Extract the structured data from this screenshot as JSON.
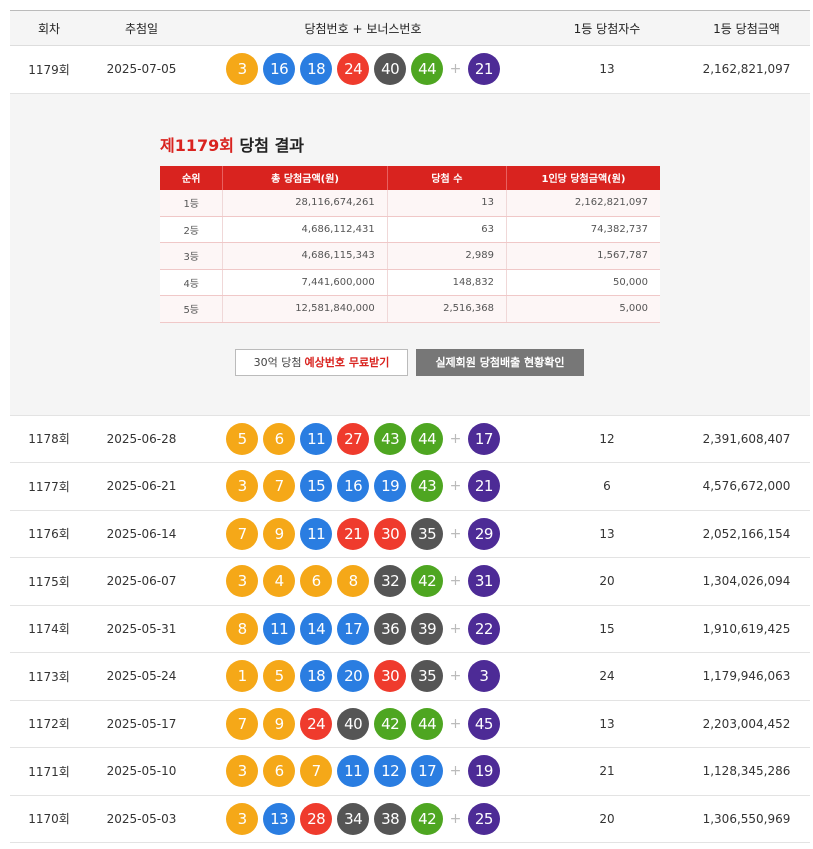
{
  "header": {
    "round": "회차",
    "date": "추첨일",
    "numbers": "당첨번호 + 보너스번호",
    "winners": "1등 당첨자수",
    "amount": "1등 당첨금액"
  },
  "colors": {
    "yellow": "#f5a818",
    "blue": "#2a7de1",
    "red": "#ef3b2d",
    "gray": "#555555",
    "green": "#4ea621",
    "bonus": "#4d2b96",
    "accent": "#d9231f"
  },
  "rows": [
    {
      "round": "1179회",
      "date": "2025-07-05",
      "balls": [
        "3",
        "16",
        "18",
        "24",
        "40",
        "44"
      ],
      "colors": [
        "y",
        "b",
        "b",
        "r",
        "g",
        "gr"
      ],
      "bonus": "21",
      "winners": "13",
      "amount": "2,162,821,097"
    },
    {
      "round": "1178회",
      "date": "2025-06-28",
      "balls": [
        "5",
        "6",
        "11",
        "27",
        "43",
        "44"
      ],
      "colors": [
        "y",
        "y",
        "b",
        "r",
        "gr",
        "gr"
      ],
      "bonus": "17",
      "winners": "12",
      "amount": "2,391,608,407"
    },
    {
      "round": "1177회",
      "date": "2025-06-21",
      "balls": [
        "3",
        "7",
        "15",
        "16",
        "19",
        "43"
      ],
      "colors": [
        "y",
        "y",
        "b",
        "b",
        "b",
        "gr"
      ],
      "bonus": "21",
      "winners": "6",
      "amount": "4,576,672,000"
    },
    {
      "round": "1176회",
      "date": "2025-06-14",
      "balls": [
        "7",
        "9",
        "11",
        "21",
        "30",
        "35"
      ],
      "colors": [
        "y",
        "y",
        "b",
        "r",
        "r",
        "g"
      ],
      "bonus": "29",
      "winners": "13",
      "amount": "2,052,166,154"
    },
    {
      "round": "1175회",
      "date": "2025-06-07",
      "balls": [
        "3",
        "4",
        "6",
        "8",
        "32",
        "42"
      ],
      "colors": [
        "y",
        "y",
        "y",
        "y",
        "g",
        "gr"
      ],
      "bonus": "31",
      "winners": "20",
      "amount": "1,304,026,094"
    },
    {
      "round": "1174회",
      "date": "2025-05-31",
      "balls": [
        "8",
        "11",
        "14",
        "17",
        "36",
        "39"
      ],
      "colors": [
        "y",
        "b",
        "b",
        "b",
        "g",
        "g"
      ],
      "bonus": "22",
      "winners": "15",
      "amount": "1,910,619,425"
    },
    {
      "round": "1173회",
      "date": "2025-05-24",
      "balls": [
        "1",
        "5",
        "18",
        "20",
        "30",
        "35"
      ],
      "colors": [
        "y",
        "y",
        "b",
        "b",
        "r",
        "g"
      ],
      "bonus": "3",
      "winners": "24",
      "amount": "1,179,946,063"
    },
    {
      "round": "1172회",
      "date": "2025-05-17",
      "balls": [
        "7",
        "9",
        "24",
        "40",
        "42",
        "44"
      ],
      "colors": [
        "y",
        "y",
        "r",
        "g",
        "gr",
        "gr"
      ],
      "bonus": "45",
      "winners": "13",
      "amount": "2,203,004,452"
    },
    {
      "round": "1171회",
      "date": "2025-05-10",
      "balls": [
        "3",
        "6",
        "7",
        "11",
        "12",
        "17"
      ],
      "colors": [
        "y",
        "y",
        "y",
        "b",
        "b",
        "b"
      ],
      "bonus": "19",
      "winners": "21",
      "amount": "1,128,345,286"
    },
    {
      "round": "1170회",
      "date": "2025-05-03",
      "balls": [
        "3",
        "13",
        "28",
        "34",
        "38",
        "42"
      ],
      "colors": [
        "y",
        "b",
        "r",
        "g",
        "g",
        "gr"
      ],
      "bonus": "25",
      "winners": "20",
      "amount": "1,306,550,969"
    }
  ],
  "plus_symbol": "+",
  "detail": {
    "title_round": "제1179회",
    "title_rest": " 당첨 결과",
    "table_headers": [
      "순위",
      "총 당첨금액(원)",
      "당첨 수",
      "1인당 당첨금액(원)"
    ],
    "table_rows": [
      [
        "1등",
        "28,116,674,261",
        "13",
        "2,162,821,097"
      ],
      [
        "2등",
        "4,686,112,431",
        "63",
        "74,382,737"
      ],
      [
        "3등",
        "4,686,115,343",
        "2,989",
        "1,567,787"
      ],
      [
        "4등",
        "7,441,600,000",
        "148,832",
        "50,000"
      ],
      [
        "5등",
        "12,581,840,000",
        "2,516,368",
        "5,000"
      ]
    ],
    "btn_predict_prefix": "30억 당첨",
    "btn_predict_highlight": "예상번호 무료받기",
    "btn_members": "실제회원 당첨배출 현황확인"
  }
}
